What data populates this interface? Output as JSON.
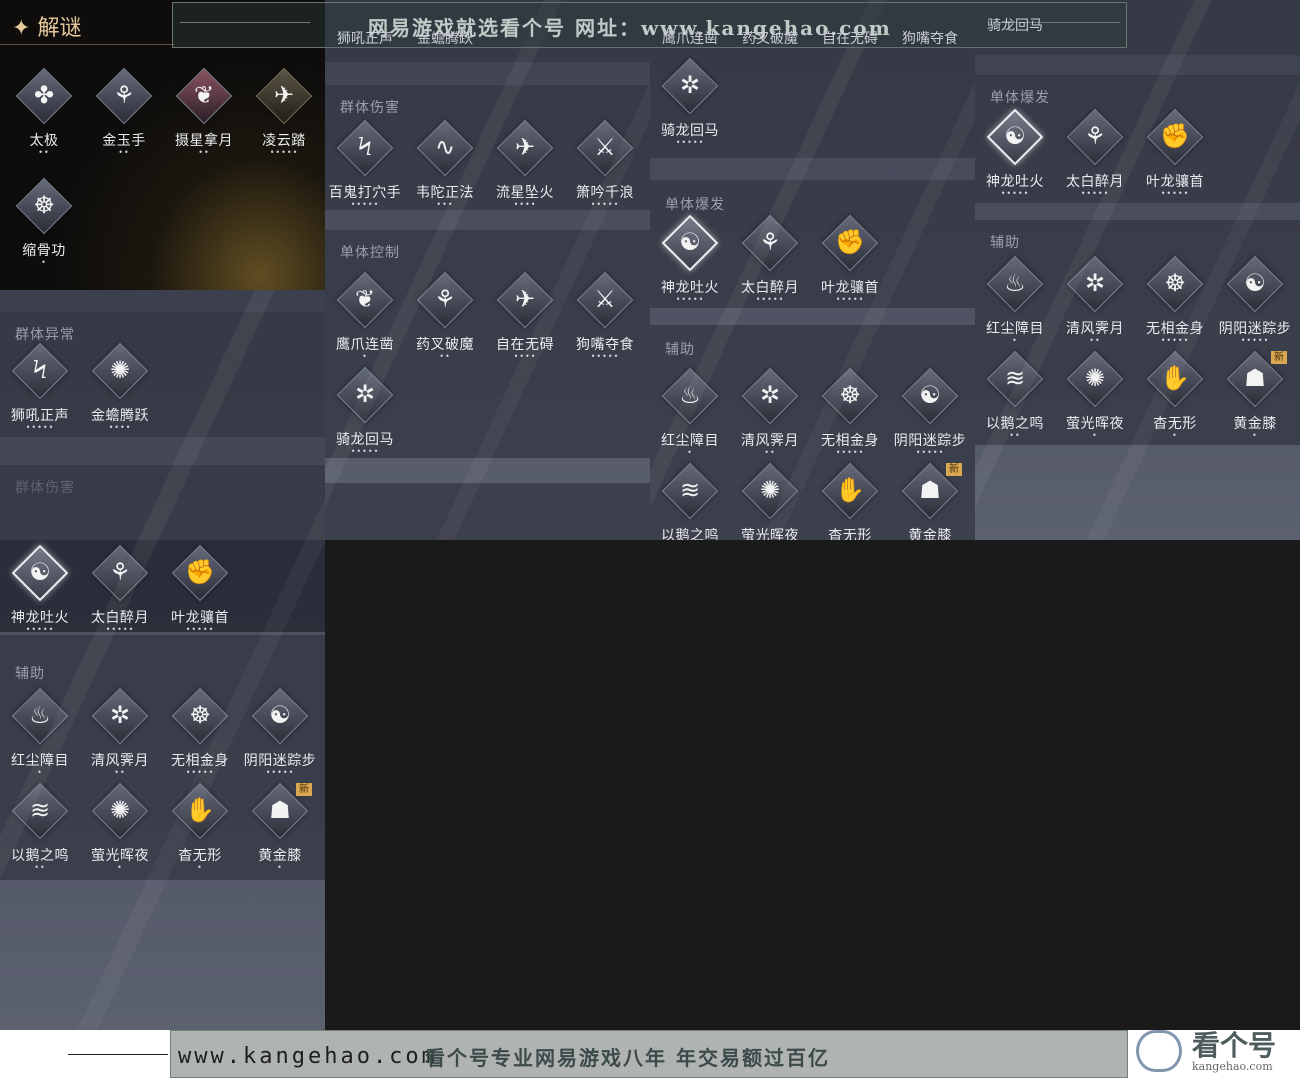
{
  "icon_glyphs": {
    "swirl-icon": "✤",
    "kick-icon": "⚘",
    "claw-icon": "❦",
    "cloud-step-icon": "✈",
    "meditate-icon": "☸",
    "strike-icon": "Ϟ",
    "boot-icon": "∿",
    "slash-icon": "⚔",
    "dragon-icon": "☯",
    "yinyang-icon": "☯",
    "fist-icon": "✊",
    "shield-icon": "❖",
    "wind-icon": "✲",
    "sword-icon": "⚔",
    "fan-icon": "≋",
    "hand-icon": "✋",
    "drum-icon": "◉",
    "fire-icon": "♨",
    "knee-icon": "☗",
    "spin-icon": "✺",
    "fly-icon": "✈"
  },
  "puzzle": {
    "title": "解谜",
    "skills": [
      {
        "name": "太极",
        "dots": "••",
        "icon": "swirl-icon",
        "style": ""
      },
      {
        "name": "金玉手",
        "dots": "••",
        "icon": "kick-icon",
        "style": ""
      },
      {
        "name": "摄星拿月",
        "dots": "••",
        "icon": "claw-icon",
        "style": "red"
      },
      {
        "name": "凌云踏",
        "dots": "•••••",
        "icon": "cloud-step-icon",
        "style": "gold"
      },
      {
        "name": "缩骨功",
        "dots": "•",
        "icon": "meditate-icon",
        "style": ""
      }
    ]
  },
  "watermark": {
    "top": "网易游戏就选看个号  网址：www.kangehao.com",
    "foot_url": "www.kangehao.com",
    "foot_slogan": "看个号专业网易游戏八年  年交易额过百亿",
    "brand": "看个号",
    "brand_domain": "kangehao.com"
  },
  "col1": {
    "s1_title": "群体异常",
    "s1": [
      {
        "name": "狮吼正声",
        "dots": "•••••",
        "icon": "strike-icon"
      },
      {
        "name": "金蟾腾跃",
        "dots": "••••",
        "icon": "spin-icon"
      }
    ],
    "s2_title": "群体伤害",
    "s3": [
      {
        "name": "神龙吐火",
        "dots": "•••••",
        "icon": "dragon-icon",
        "sel": true
      },
      {
        "name": "太白醉月",
        "dots": "•••••",
        "icon": "kick-icon"
      },
      {
        "name": "叶龙骧首",
        "dots": "•••••",
        "icon": "fist-icon"
      }
    ],
    "s4_title": "辅助",
    "s4": [
      {
        "name": "红尘障目",
        "dots": "•",
        "icon": "fire-icon"
      },
      {
        "name": "清风霁月",
        "dots": "••",
        "icon": "wind-icon"
      },
      {
        "name": "无相金身",
        "dots": "•••••",
        "icon": "meditate-icon"
      },
      {
        "name": "阴阳迷踪步",
        "dots": "•••••",
        "icon": "yinyang-icon"
      },
      {
        "name": "以鹅之鸣",
        "dots": "••",
        "icon": "fan-icon"
      },
      {
        "name": "萤光晖夜",
        "dots": "•",
        "icon": "spin-icon"
      },
      {
        "name": "杳无形",
        "dots": "•",
        "icon": "hand-icon"
      },
      {
        "name": "黄金膝",
        "dots": "•",
        "icon": "knee-icon",
        "badge": "新"
      }
    ]
  },
  "col2": {
    "top_labels": [
      "狮吼正声",
      "金蟾腾跃"
    ],
    "s1_title": "群体伤害",
    "s1": [
      {
        "name": "百鬼打穴手",
        "dots": "•••••",
        "icon": "strike-icon"
      },
      {
        "name": "韦陀正法",
        "dots": "•••",
        "icon": "boot-icon"
      },
      {
        "name": "流星坠火",
        "dots": "••••",
        "icon": "fly-icon"
      },
      {
        "name": "箫吟千浪",
        "dots": "•••••",
        "icon": "sword-icon"
      }
    ],
    "s2_title": "单体控制",
    "s2": [
      {
        "name": "鹰爪连凿",
        "dots": "•",
        "icon": "claw-icon"
      },
      {
        "name": "药叉破魔",
        "dots": "••",
        "icon": "kick-icon"
      },
      {
        "name": "自在无碍",
        "dots": "••••",
        "icon": "cloud-step-icon"
      },
      {
        "name": "狗嘴夺食",
        "dots": "•••••",
        "icon": "slash-icon"
      },
      {
        "name": "骑龙回马",
        "dots": "•••••",
        "icon": "wind-icon"
      }
    ]
  },
  "col3": {
    "top_labels": [
      "鹰爪连凿",
      "药叉破魔",
      "自在无碍",
      "狗嘴夺食"
    ],
    "s0": [
      {
        "name": "骑龙回马",
        "dots": "•••••",
        "icon": "wind-icon"
      }
    ],
    "s1_title": "单体爆发",
    "s1": [
      {
        "name": "神龙吐火",
        "dots": "•••••",
        "icon": "dragon-icon",
        "sel": true
      },
      {
        "name": "太白醉月",
        "dots": "•••••",
        "icon": "kick-icon"
      },
      {
        "name": "叶龙骧首",
        "dots": "•••••",
        "icon": "fist-icon"
      }
    ],
    "s2_title": "辅助",
    "s2": [
      {
        "name": "红尘障目",
        "dots": "•",
        "icon": "fire-icon"
      },
      {
        "name": "清风霁月",
        "dots": "••",
        "icon": "wind-icon"
      },
      {
        "name": "无相金身",
        "dots": "•••••",
        "icon": "meditate-icon"
      },
      {
        "name": "阴阳迷踪步",
        "dots": "•••••",
        "icon": "yinyang-icon"
      },
      {
        "name": "以鹅之鸣",
        "dots": "",
        "icon": "fan-icon"
      },
      {
        "name": "萤光晖夜",
        "dots": "",
        "icon": "spin-icon"
      },
      {
        "name": "杳无形",
        "dots": "",
        "icon": "hand-icon"
      },
      {
        "name": "黄金膝",
        "dots": "",
        "icon": "knee-icon",
        "badge": "新"
      }
    ]
  },
  "col4": {
    "top_labels": [
      "骑龙回马"
    ],
    "s1_title": "单体爆发",
    "s1": [
      {
        "name": "神龙吐火",
        "dots": "•••••",
        "icon": "dragon-icon",
        "sel": true
      },
      {
        "name": "太白醉月",
        "dots": "•••••",
        "icon": "kick-icon"
      },
      {
        "name": "叶龙骧首",
        "dots": "•••••",
        "icon": "fist-icon"
      }
    ],
    "s2_title": "辅助",
    "s2": [
      {
        "name": "红尘障目",
        "dots": "•",
        "icon": "fire-icon"
      },
      {
        "name": "清风霁月",
        "dots": "••",
        "icon": "wind-icon"
      },
      {
        "name": "无相金身",
        "dots": "•••••",
        "icon": "meditate-icon"
      },
      {
        "name": "阴阳迷踪步",
        "dots": "•••••",
        "icon": "yinyang-icon"
      },
      {
        "name": "以鹅之鸣",
        "dots": "••",
        "icon": "fan-icon"
      },
      {
        "name": "萤光晖夜",
        "dots": "•",
        "icon": "spin-icon"
      },
      {
        "name": "杳无形",
        "dots": "•",
        "icon": "hand-icon"
      },
      {
        "name": "黄金膝",
        "dots": "•",
        "icon": "knee-icon",
        "badge": "新"
      }
    ]
  }
}
